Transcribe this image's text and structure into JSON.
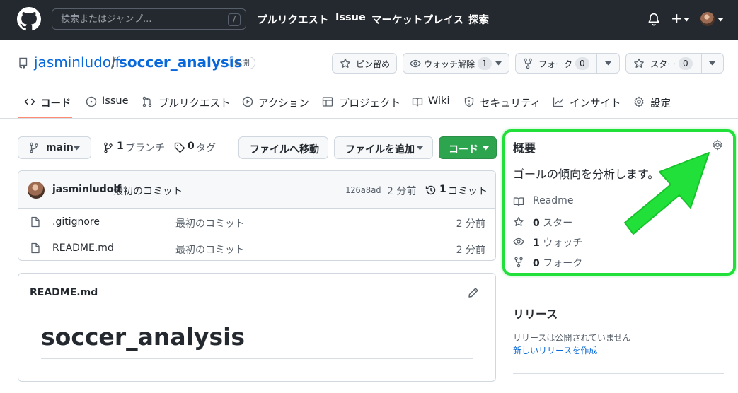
{
  "header": {
    "search_placeholder": "検索またはジャンプ...",
    "search_shortcut": "/",
    "nav": [
      "プルリクエスト",
      "Issue",
      "マーケットプレイス",
      "探索"
    ],
    "plus_label": "+"
  },
  "repo": {
    "owner": "jasminludolf",
    "separator": "/",
    "name": "soccer_analysis",
    "visibility": "公開",
    "actions": {
      "pin": "ピン留め",
      "watch": "ウォッチ解除",
      "watch_count": "1",
      "fork": "フォーク",
      "fork_count": "0",
      "star": "スター",
      "star_count": "0"
    }
  },
  "tabs": [
    "コード",
    "Issue",
    "プルリクエスト",
    "アクション",
    "プロジェクト",
    "Wiki",
    "セキュリティ",
    "インサイト",
    "設定"
  ],
  "branch_bar": {
    "branch": "main",
    "branch_count": "1",
    "branch_label": "ブランチ",
    "tag_count": "0",
    "tag_label": "タグ",
    "goto_file": "ファイルへ移動",
    "add_file": "ファイルを追加",
    "code": "コード"
  },
  "latest_commit": {
    "author": "jasminludolf",
    "message": "最初のコミット",
    "sha": "126a8ad",
    "age": "2 分前",
    "commit_count": "1",
    "commit_label": "コミット"
  },
  "files": [
    {
      "name": ".gitignore",
      "message": "最初のコミット",
      "age": "2 分前"
    },
    {
      "name": "README.md",
      "message": "最初のコミット",
      "age": "2 分前"
    }
  ],
  "readme": {
    "filename": "README.md",
    "heading": "soccer_analysis"
  },
  "about": {
    "title": "概要",
    "description": "ゴールの傾向を分析します。",
    "readme_label": "Readme",
    "stars_count": "0",
    "stars_label": "スター",
    "watch_count": "1",
    "watch_label": "ウォッチ",
    "forks_count": "0",
    "forks_label": "フォーク"
  },
  "releases": {
    "title": "リリース",
    "empty_text": "リリースは公開されていません",
    "create_link": "新しいリリースを作成"
  },
  "colors": {
    "header_bg": "#24292f",
    "link": "#0969da",
    "primary_green": "#2da44e",
    "annotation_green": "#22e03a",
    "tab_underline": "#fd8c73"
  }
}
